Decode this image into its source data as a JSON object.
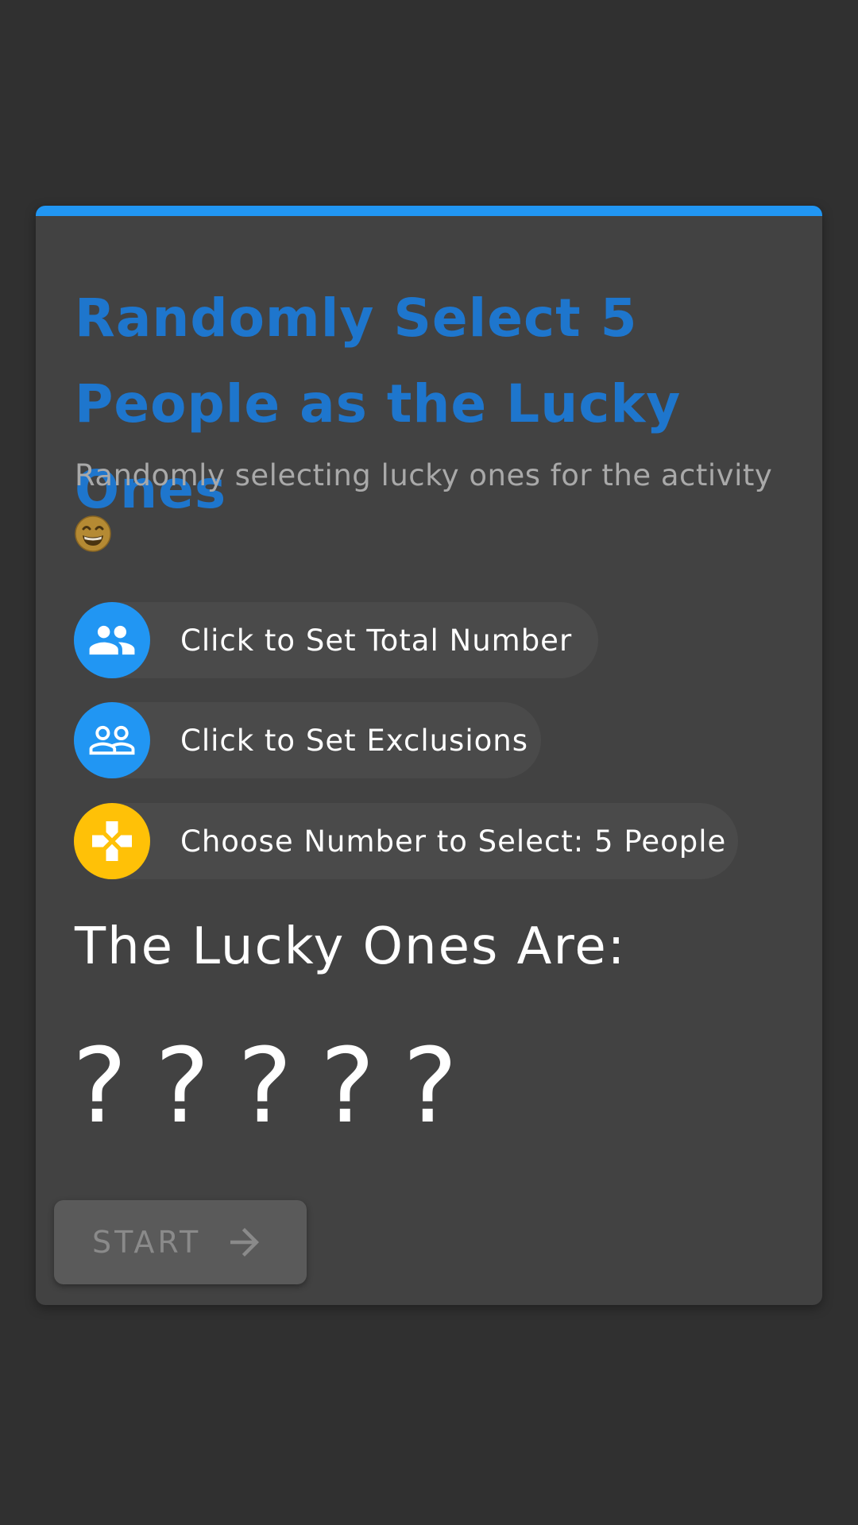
{
  "header": {
    "title": "Randomly Select 5 People as the Lucky Ones",
    "subtitle": "Randomly selecting lucky ones for the activity"
  },
  "options": {
    "total_label": "Click to Set Total Number",
    "exclusions_label": "Click to Set Exclusions",
    "count_label": "Choose Number to Select: 5 People"
  },
  "result": {
    "heading": "The Lucky Ones Are:",
    "slots": [
      "?",
      "?",
      "?",
      "?",
      "?"
    ]
  },
  "actions": {
    "start_label": "START"
  },
  "icons": {
    "total": "people-icon",
    "exclusions": "people-outline-icon",
    "count": "gamepad-icon",
    "start": "arrow-right-icon",
    "emoji": "grinning-face-icon"
  },
  "colors": {
    "accent": "#2196f3",
    "title": "#1e76cd",
    "warning": "#ffc107",
    "card": "#424242",
    "background": "#303030"
  }
}
